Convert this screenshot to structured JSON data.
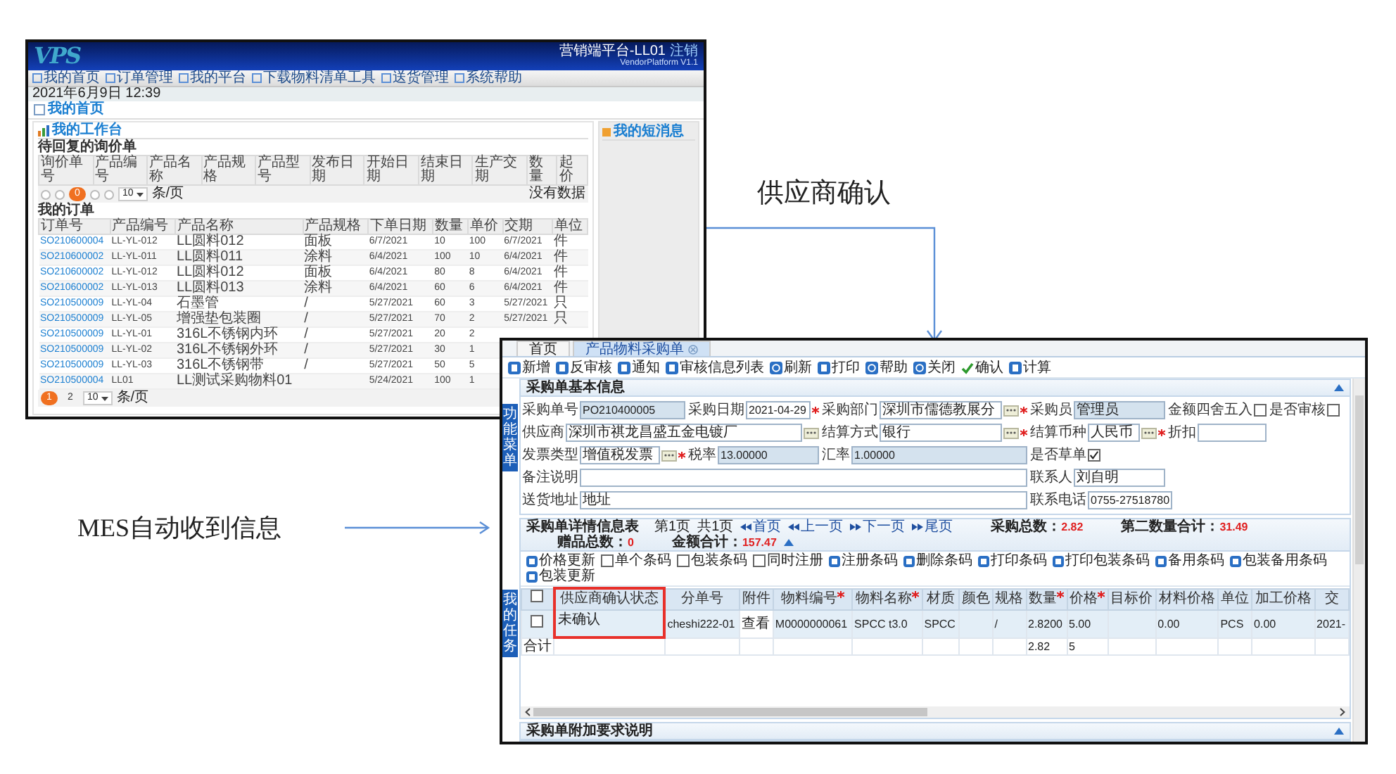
{
  "slide": {
    "caption_top": "供应商确认",
    "caption_left": "MES自动收到信息"
  },
  "portal": {
    "logo": "VPS",
    "user": "营销端平台-LL01",
    "logout": "注销",
    "version": "VendorPlatform V1.1",
    "nav": [
      "我的首页",
      "订单管理",
      "我的平台",
      "下载物料清单工具",
      "送货管理",
      "系统帮助"
    ],
    "date": "2021年6月9日 12:39",
    "breadcrumb": "我的首页",
    "workbench": "我的工作台",
    "messages": "我的短消息",
    "inquiry": {
      "title": "待回复的询价单",
      "columns": [
        "询价单号",
        "产品编号",
        "产品名称",
        "产品规格",
        "产品型号",
        "发布日期",
        "开始日期",
        "结束日期",
        "生产交期",
        "数量",
        "起价"
      ],
      "pager": {
        "page": "0",
        "size": "10",
        "unit": "条/页"
      },
      "empty": "没有数据"
    },
    "orders": {
      "title": "我的订单",
      "columns": [
        "订单号",
        "产品编号",
        "产品名称",
        "产品规格",
        "下单日期",
        "数量",
        "单价",
        "交期",
        "单位"
      ],
      "rows": [
        {
          "cells": [
            "SO210600004",
            "LL-YL-012",
            "LL圆料012",
            "面板",
            "6/7/2021",
            "10",
            "100",
            "6/7/2021",
            "件"
          ]
        },
        {
          "cells": [
            "SO210600002",
            "LL-YL-011",
            "LL圆料011",
            "涂料",
            "6/4/2021",
            "100",
            "10",
            "6/4/2021",
            "件"
          ]
        },
        {
          "cells": [
            "SO210600002",
            "LL-YL-012",
            "LL圆料012",
            "面板",
            "6/4/2021",
            "80",
            "8",
            "6/4/2021",
            "件"
          ]
        },
        {
          "cells": [
            "SO210600002",
            "LL-YL-013",
            "LL圆料013",
            "涂料",
            "6/4/2021",
            "60",
            "6",
            "6/4/2021",
            "件"
          ]
        },
        {
          "cells": [
            "SO210500009",
            "LL-YL-04",
            "石墨管",
            "/",
            "5/27/2021",
            "60",
            "3",
            "5/27/2021",
            "只"
          ]
        },
        {
          "cells": [
            "SO210500009",
            "LL-YL-05",
            "增强垫包装圈",
            "/",
            "5/27/2021",
            "70",
            "2",
            "5/27/2021",
            "只"
          ]
        },
        {
          "cells": [
            "SO210500009",
            "LL-YL-01",
            "316L不锈钢内环",
            "/",
            "5/27/2021",
            "20",
            "2"
          ]
        },
        {
          "cells": [
            "SO210500009",
            "LL-YL-02",
            "316L不锈钢外环",
            "/",
            "5/27/2021",
            "30",
            "1"
          ]
        },
        {
          "cells": [
            "SO210500009",
            "LL-YL-03",
            "316L不锈钢带",
            "/",
            "5/27/2021",
            "50",
            "5"
          ]
        },
        {
          "cells": [
            "SO210500004",
            "LL01",
            "LL测试采购物料01",
            null,
            "5/24/2021",
            "100",
            "1"
          ]
        }
      ],
      "pager": {
        "pages": [
          {
            "label": "1",
            "selected": true
          },
          {
            "label": "2",
            "selected": false
          }
        ],
        "size": "10",
        "unit": "条/页"
      }
    }
  },
  "po": {
    "tabs": [
      {
        "label": "首页",
        "selected": false
      },
      {
        "label": "产品物料采购单",
        "selected": true
      }
    ],
    "toolbar": [
      {
        "label": "新增"
      },
      {
        "label": "反审核"
      },
      {
        "label": "通知"
      },
      {
        "label": "审核信息列表"
      },
      {
        "label": "刷新"
      },
      {
        "label": "打印"
      },
      {
        "label": "帮助"
      },
      {
        "label": "关闭"
      },
      {
        "label": "确认"
      },
      {
        "label": "计算"
      }
    ],
    "side_tabs": [
      "功能菜单",
      "我的任务"
    ],
    "basic": {
      "title": "采购单基本信息",
      "rows": [
        [
          {
            "label": "采购单号",
            "kind": "readonly",
            "value": "PO210400005"
          },
          {
            "label": "采购日期",
            "kind": "text",
            "value": "2021-04-29",
            "required": true
          },
          {
            "label": "采购部门",
            "kind": "lookup",
            "value": "深圳市儒德教展分",
            "required": true
          },
          {
            "label": "采购员",
            "kind": "readonly",
            "value": "管理员"
          },
          {
            "label": "金额四舍五入",
            "kind": "checkbox",
            "checked": false
          },
          {
            "label": "是否审核",
            "kind": "checkbox",
            "checked": false
          }
        ],
        [
          {
            "label": "供应商",
            "kind": "lookup",
            "value": "深圳市祺龙昌盛五金电镀厂"
          },
          null,
          {
            "label": "结算方式",
            "kind": "lookup",
            "value": "银行",
            "required": true
          },
          {
            "label": "结算币种",
            "kind": "lookup",
            "value": "人民币",
            "required": true
          },
          {
            "label": "折扣",
            "kind": "text"
          }
        ],
        [
          {
            "label": "发票类型",
            "kind": "lookup",
            "value": "增值税发票",
            "required": true
          },
          {
            "label": "税率",
            "kind": "readonly",
            "value": "13.00000"
          },
          {
            "label": "汇率",
            "kind": "readonly",
            "value": "1.00000"
          },
          {
            "label": "是否草单",
            "kind": "checkbox",
            "checked": true
          }
        ],
        [
          {
            "label": "备注说明",
            "kind": "text"
          },
          null,
          null,
          {
            "label": "联系人",
            "kind": "text",
            "value": "刘自明"
          }
        ],
        [
          {
            "label": "送货地址",
            "kind": "text",
            "value": "地址"
          },
          null,
          null,
          {
            "label": "联系电话",
            "kind": "text",
            "value": "0755-27518780"
          }
        ]
      ]
    },
    "details": {
      "title": "采购单详情信息表",
      "page": "第1页",
      "total": "共1页",
      "nav": [
        "首页",
        "上一页",
        "下一页",
        "尾页"
      ],
      "stats": [
        {
          "label": "采购总数：",
          "value": "2.82"
        },
        {
          "label": "第二数量合计：",
          "value": "31.49"
        },
        {
          "label": "赠品总数：",
          "value": "0"
        },
        {
          "label": "金额合计：",
          "value": "157.47"
        }
      ],
      "toolbar": [
        {
          "kind": "button",
          "label": "价格更新"
        },
        {
          "kind": "checkbox",
          "label": "单个条码",
          "checked": false
        },
        {
          "kind": "checkbox",
          "label": "包装条码",
          "checked": false
        },
        {
          "kind": "checkbox",
          "label": "同时注册",
          "checked": false
        },
        {
          "kind": "button",
          "label": "注册条码"
        },
        {
          "kind": "button",
          "label": "删除条码"
        },
        {
          "kind": "button",
          "label": "打印条码"
        },
        {
          "kind": "button",
          "label": "打印包装条码"
        },
        {
          "kind": "button",
          "label": "备用条码"
        },
        {
          "kind": "button",
          "label": "包装备用条码"
        },
        {
          "kind": "button",
          "label": "包装更新"
        }
      ],
      "all_checked": false,
      "columns": [
        {
          "label": "供应商确认状态",
          "highlighted": true
        },
        {
          "label": "分单号"
        },
        {
          "label": "附件"
        },
        {
          "label": "物料编号",
          "required": true
        },
        {
          "label": "物料名称",
          "required": true
        },
        {
          "label": "材质"
        },
        {
          "label": "颜色"
        },
        {
          "label": "规格"
        },
        {
          "label": "数量",
          "required": true
        },
        {
          "label": "价格",
          "required": true
        },
        {
          "label": "目标价"
        },
        {
          "label": "材料价格"
        },
        {
          "label": "单位"
        },
        {
          "label": "加工价格"
        },
        {
          "label": "交"
        }
      ],
      "rows": [
        {
          "checked": false,
          "cells": [
            "未确认",
            "cheshi222-01",
            "查看",
            "M0000000061",
            "SPCC t3.0",
            "SPCC",
            null,
            "/",
            "2.8200",
            "5.00",
            null,
            "0.00",
            "PCS",
            "0.00",
            "2021-"
          ]
        }
      ],
      "totals": {
        "label": "合计",
        "cells": [
          null,
          null,
          null,
          null,
          null,
          null,
          null,
          null,
          "2.82",
          "5",
          null,
          null,
          null,
          null,
          null
        ]
      }
    },
    "footer": "采购单附加要求说明"
  }
}
